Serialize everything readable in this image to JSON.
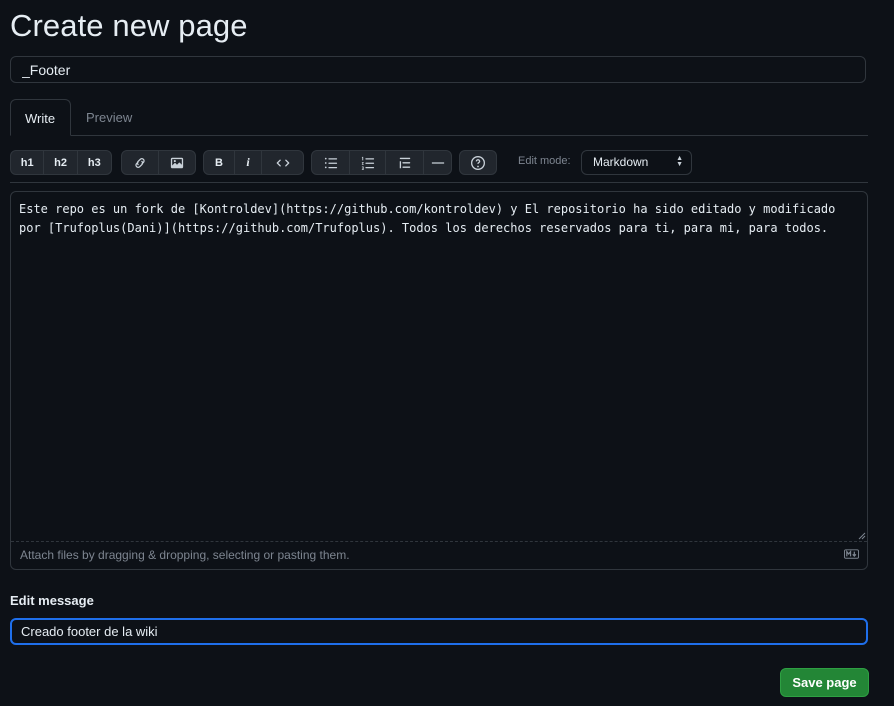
{
  "page": {
    "title": "Create new page",
    "page_name_value": "_Footer"
  },
  "tabs": [
    {
      "label": "Write",
      "active": true
    },
    {
      "label": "Preview",
      "active": false
    }
  ],
  "toolbar": {
    "headings": [
      "h1",
      "h2",
      "h3"
    ],
    "bold": "B",
    "italic": "i",
    "icons": [
      "link-icon",
      "image-icon",
      "code-icon",
      "unordered-list-icon",
      "ordered-list-icon",
      "task-list-icon",
      "horizontal-rule-icon",
      "help-icon"
    ],
    "edit_mode_label": "Edit mode:",
    "edit_mode_value": "Markdown"
  },
  "editor": {
    "content": "Este repo es un fork de [Kontroldev](https://github.com/kontroldev) y El repositorio ha sido editado y modificado por [Trufoplus(Dani)](https://github.com/Trufoplus). Todos los derechos reservados para ti, para mi, para todos.",
    "attach_hint": "Attach files by dragging & dropping, selecting or pasting them."
  },
  "edit_message": {
    "label": "Edit message",
    "value": "Creado footer de la wiki"
  },
  "save_button": "Save page",
  "colors": {
    "background": "#0d1117",
    "border": "#30363d",
    "primary_button": "#238636",
    "focus": "#1f6feb"
  }
}
